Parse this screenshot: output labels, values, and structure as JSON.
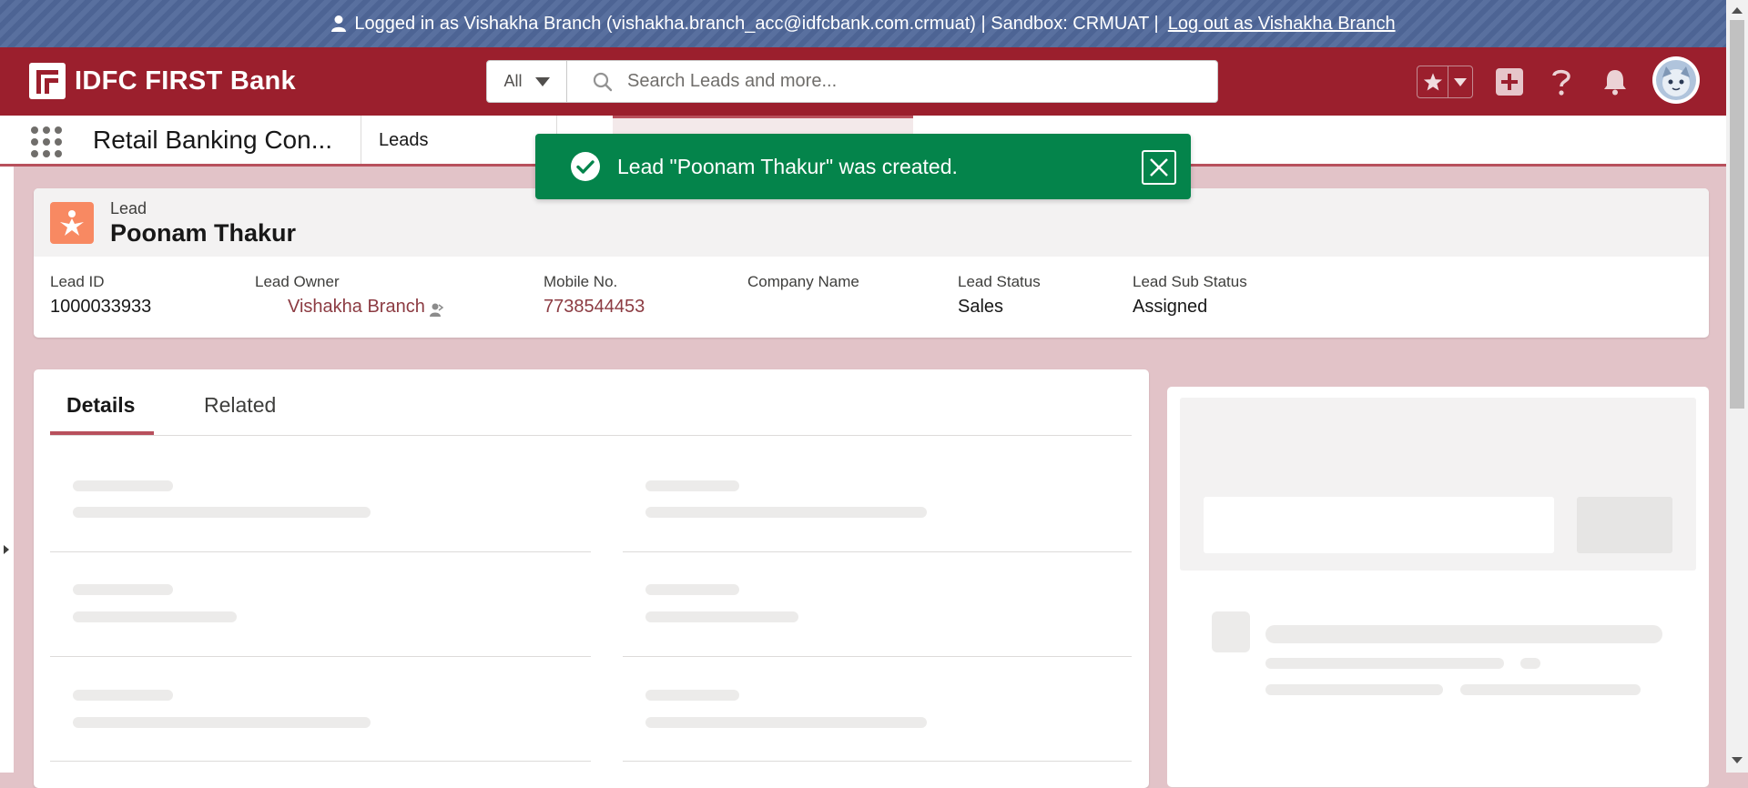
{
  "banner": {
    "text": "Logged in as Vishakha Branch (vishakha.branch_acc@idfcbank.com.crmuat) | Sandbox: CRMUAT |",
    "logout_link": "Log out as Vishakha Branch"
  },
  "header": {
    "brand": "IDFC FIRST Bank",
    "search_scope": "All",
    "search_placeholder": "Search Leads and more..."
  },
  "nav": {
    "app_name": "Retail Banking Con...",
    "tabs": [
      {
        "label": "Leads"
      }
    ]
  },
  "toast": {
    "message": "Lead \"Poonam Thakur\" was created."
  },
  "record": {
    "type": "Lead",
    "name": "Poonam Thakur",
    "fields": [
      {
        "label": "Lead ID",
        "value": "1000033933"
      },
      {
        "label": "Lead Owner",
        "value": "Vishakha Branch"
      },
      {
        "label": "Mobile No.",
        "value": "7738544453"
      },
      {
        "label": "Company Name",
        "value": ""
      },
      {
        "label": "Lead Status",
        "value": "Sales"
      },
      {
        "label": "Lead Sub Status",
        "value": "Assigned"
      }
    ]
  },
  "detail_tabs": [
    {
      "label": "Details"
    },
    {
      "label": "Related"
    }
  ],
  "colors": {
    "header": "#9b1f2d",
    "toast_success": "#04844b",
    "lead_icon": "#f88962",
    "accent": "#b8505c"
  }
}
